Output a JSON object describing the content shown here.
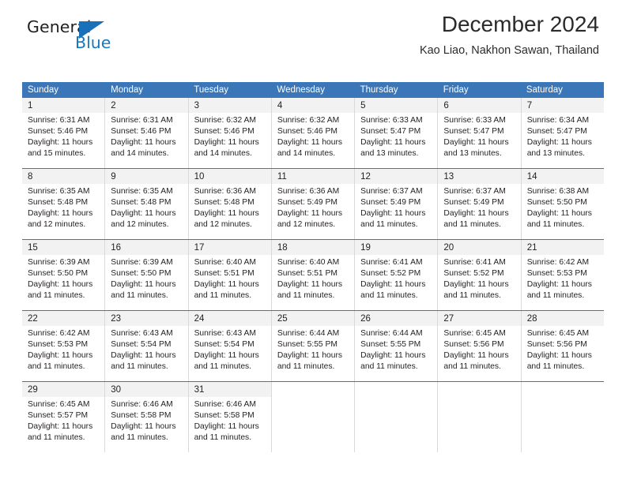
{
  "brand": {
    "name_top": "General",
    "name_bottom": "Blue",
    "accent_color": "#1870b8"
  },
  "header": {
    "title": "December 2024",
    "subtitle": "Kao Liao, Nakhon Sawan, Thailand"
  },
  "theme": {
    "header_blue": "#3b76b8",
    "daynum_gray": "#f2f2f2",
    "border_gray": "#d9d9d9",
    "text": "#231f20"
  },
  "weekdays": [
    "Sunday",
    "Monday",
    "Tuesday",
    "Wednesday",
    "Thursday",
    "Friday",
    "Saturday"
  ],
  "weeks": [
    [
      {
        "day": "1",
        "sunrise": "Sunrise: 6:31 AM",
        "sunset": "Sunset: 5:46 PM",
        "daylight1": "Daylight: 11 hours",
        "daylight2": "and 15 minutes."
      },
      {
        "day": "2",
        "sunrise": "Sunrise: 6:31 AM",
        "sunset": "Sunset: 5:46 PM",
        "daylight1": "Daylight: 11 hours",
        "daylight2": "and 14 minutes."
      },
      {
        "day": "3",
        "sunrise": "Sunrise: 6:32 AM",
        "sunset": "Sunset: 5:46 PM",
        "daylight1": "Daylight: 11 hours",
        "daylight2": "and 14 minutes."
      },
      {
        "day": "4",
        "sunrise": "Sunrise: 6:32 AM",
        "sunset": "Sunset: 5:46 PM",
        "daylight1": "Daylight: 11 hours",
        "daylight2": "and 14 minutes."
      },
      {
        "day": "5",
        "sunrise": "Sunrise: 6:33 AM",
        "sunset": "Sunset: 5:47 PM",
        "daylight1": "Daylight: 11 hours",
        "daylight2": "and 13 minutes."
      },
      {
        "day": "6",
        "sunrise": "Sunrise: 6:33 AM",
        "sunset": "Sunset: 5:47 PM",
        "daylight1": "Daylight: 11 hours",
        "daylight2": "and 13 minutes."
      },
      {
        "day": "7",
        "sunrise": "Sunrise: 6:34 AM",
        "sunset": "Sunset: 5:47 PM",
        "daylight1": "Daylight: 11 hours",
        "daylight2": "and 13 minutes."
      }
    ],
    [
      {
        "day": "8",
        "sunrise": "Sunrise: 6:35 AM",
        "sunset": "Sunset: 5:48 PM",
        "daylight1": "Daylight: 11 hours",
        "daylight2": "and 12 minutes."
      },
      {
        "day": "9",
        "sunrise": "Sunrise: 6:35 AM",
        "sunset": "Sunset: 5:48 PM",
        "daylight1": "Daylight: 11 hours",
        "daylight2": "and 12 minutes."
      },
      {
        "day": "10",
        "sunrise": "Sunrise: 6:36 AM",
        "sunset": "Sunset: 5:48 PM",
        "daylight1": "Daylight: 11 hours",
        "daylight2": "and 12 minutes."
      },
      {
        "day": "11",
        "sunrise": "Sunrise: 6:36 AM",
        "sunset": "Sunset: 5:49 PM",
        "daylight1": "Daylight: 11 hours",
        "daylight2": "and 12 minutes."
      },
      {
        "day": "12",
        "sunrise": "Sunrise: 6:37 AM",
        "sunset": "Sunset: 5:49 PM",
        "daylight1": "Daylight: 11 hours",
        "daylight2": "and 11 minutes."
      },
      {
        "day": "13",
        "sunrise": "Sunrise: 6:37 AM",
        "sunset": "Sunset: 5:49 PM",
        "daylight1": "Daylight: 11 hours",
        "daylight2": "and 11 minutes."
      },
      {
        "day": "14",
        "sunrise": "Sunrise: 6:38 AM",
        "sunset": "Sunset: 5:50 PM",
        "daylight1": "Daylight: 11 hours",
        "daylight2": "and 11 minutes."
      }
    ],
    [
      {
        "day": "15",
        "sunrise": "Sunrise: 6:39 AM",
        "sunset": "Sunset: 5:50 PM",
        "daylight1": "Daylight: 11 hours",
        "daylight2": "and 11 minutes."
      },
      {
        "day": "16",
        "sunrise": "Sunrise: 6:39 AM",
        "sunset": "Sunset: 5:50 PM",
        "daylight1": "Daylight: 11 hours",
        "daylight2": "and 11 minutes."
      },
      {
        "day": "17",
        "sunrise": "Sunrise: 6:40 AM",
        "sunset": "Sunset: 5:51 PM",
        "daylight1": "Daylight: 11 hours",
        "daylight2": "and 11 minutes."
      },
      {
        "day": "18",
        "sunrise": "Sunrise: 6:40 AM",
        "sunset": "Sunset: 5:51 PM",
        "daylight1": "Daylight: 11 hours",
        "daylight2": "and 11 minutes."
      },
      {
        "day": "19",
        "sunrise": "Sunrise: 6:41 AM",
        "sunset": "Sunset: 5:52 PM",
        "daylight1": "Daylight: 11 hours",
        "daylight2": "and 11 minutes."
      },
      {
        "day": "20",
        "sunrise": "Sunrise: 6:41 AM",
        "sunset": "Sunset: 5:52 PM",
        "daylight1": "Daylight: 11 hours",
        "daylight2": "and 11 minutes."
      },
      {
        "day": "21",
        "sunrise": "Sunrise: 6:42 AM",
        "sunset": "Sunset: 5:53 PM",
        "daylight1": "Daylight: 11 hours",
        "daylight2": "and 11 minutes."
      }
    ],
    [
      {
        "day": "22",
        "sunrise": "Sunrise: 6:42 AM",
        "sunset": "Sunset: 5:53 PM",
        "daylight1": "Daylight: 11 hours",
        "daylight2": "and 11 minutes."
      },
      {
        "day": "23",
        "sunrise": "Sunrise: 6:43 AM",
        "sunset": "Sunset: 5:54 PM",
        "daylight1": "Daylight: 11 hours",
        "daylight2": "and 11 minutes."
      },
      {
        "day": "24",
        "sunrise": "Sunrise: 6:43 AM",
        "sunset": "Sunset: 5:54 PM",
        "daylight1": "Daylight: 11 hours",
        "daylight2": "and 11 minutes."
      },
      {
        "day": "25",
        "sunrise": "Sunrise: 6:44 AM",
        "sunset": "Sunset: 5:55 PM",
        "daylight1": "Daylight: 11 hours",
        "daylight2": "and 11 minutes."
      },
      {
        "day": "26",
        "sunrise": "Sunrise: 6:44 AM",
        "sunset": "Sunset: 5:55 PM",
        "daylight1": "Daylight: 11 hours",
        "daylight2": "and 11 minutes."
      },
      {
        "day": "27",
        "sunrise": "Sunrise: 6:45 AM",
        "sunset": "Sunset: 5:56 PM",
        "daylight1": "Daylight: 11 hours",
        "daylight2": "and 11 minutes."
      },
      {
        "day": "28",
        "sunrise": "Sunrise: 6:45 AM",
        "sunset": "Sunset: 5:56 PM",
        "daylight1": "Daylight: 11 hours",
        "daylight2": "and 11 minutes."
      }
    ],
    [
      {
        "day": "29",
        "sunrise": "Sunrise: 6:45 AM",
        "sunset": "Sunset: 5:57 PM",
        "daylight1": "Daylight: 11 hours",
        "daylight2": "and 11 minutes."
      },
      {
        "day": "30",
        "sunrise": "Sunrise: 6:46 AM",
        "sunset": "Sunset: 5:58 PM",
        "daylight1": "Daylight: 11 hours",
        "daylight2": "and 11 minutes."
      },
      {
        "day": "31",
        "sunrise": "Sunrise: 6:46 AM",
        "sunset": "Sunset: 5:58 PM",
        "daylight1": "Daylight: 11 hours",
        "daylight2": "and 11 minutes."
      },
      {
        "day": "",
        "sunrise": "",
        "sunset": "",
        "daylight1": "",
        "daylight2": ""
      },
      {
        "day": "",
        "sunrise": "",
        "sunset": "",
        "daylight1": "",
        "daylight2": ""
      },
      {
        "day": "",
        "sunrise": "",
        "sunset": "",
        "daylight1": "",
        "daylight2": ""
      },
      {
        "day": "",
        "sunrise": "",
        "sunset": "",
        "daylight1": "",
        "daylight2": ""
      }
    ]
  ]
}
